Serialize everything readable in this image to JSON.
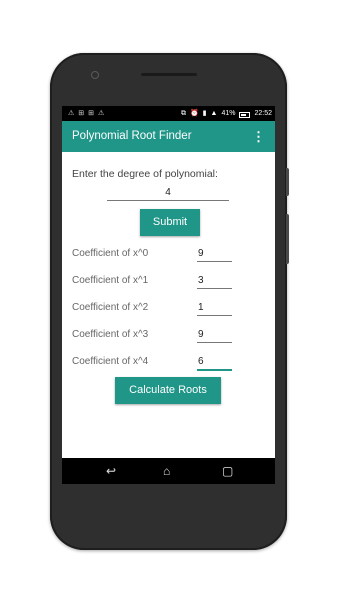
{
  "status_bar": {
    "left_icons": [
      "⚠",
      "⊞",
      "⊞",
      "⚠"
    ],
    "right_icons": [
      "⧉",
      "⏰",
      "▮",
      "▲"
    ],
    "battery_text": "41%",
    "time": "22:52"
  },
  "app_bar": {
    "title": "Polynomial Root Finder",
    "overflow_glyph": "⋮"
  },
  "form": {
    "degree_label": "Enter the degree of polynomial:",
    "degree_value": "4",
    "submit_label": "Submit",
    "coefficients": [
      {
        "label": "Coefficient of x^0",
        "value": "9"
      },
      {
        "label": "Coefficient of x^1",
        "value": "3"
      },
      {
        "label": "Coefficient of x^2",
        "value": "1"
      },
      {
        "label": "Coefficient of x^3",
        "value": "9"
      },
      {
        "label": "Coefficient of x^4",
        "value": "6"
      }
    ],
    "calculate_label": "Calculate Roots"
  },
  "nav_bar": {
    "back_glyph": "↩",
    "home_glyph": "⌂",
    "recents_glyph": "▢"
  },
  "colors": {
    "accent": "#1f9688",
    "phone_body": "#2f2f2f"
  }
}
